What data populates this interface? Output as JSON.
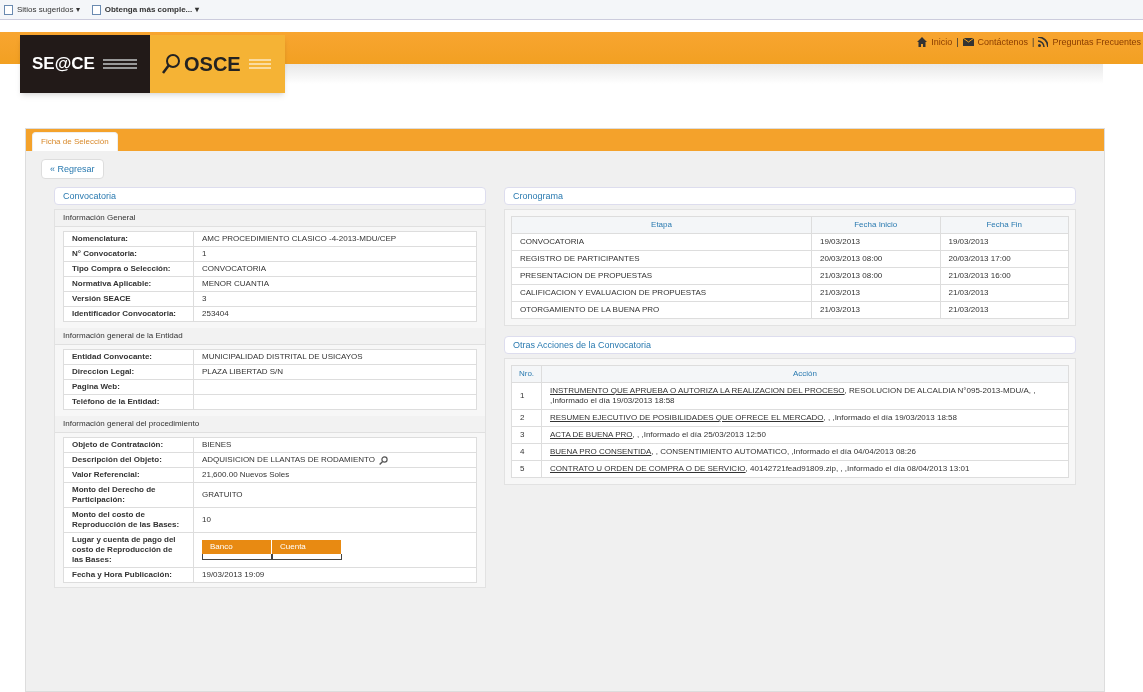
{
  "browser_bar": {
    "items": [
      "Sitios sugeridos ▾",
      "Obtenga más comple... ▾"
    ]
  },
  "header": {
    "logos": [
      "SE@CE",
      "OSCE"
    ],
    "separator": "|",
    "nav": [
      {
        "kind": "home",
        "label": "Inicio"
      },
      {
        "kind": "mail",
        "label": "Contáctenos"
      },
      {
        "kind": "rss",
        "label": "Preguntas Frecuentes"
      }
    ]
  },
  "tabs": [
    {
      "label": "Ficha de Selección",
      "selected": true
    }
  ],
  "back_button": "« Regresar",
  "convocatoria": {
    "legend": "Convocatoria",
    "sections": [
      {
        "title": "Información General",
        "rows": [
          {
            "kind": "text",
            "label": "Nomenclatura:",
            "value": "AMC PROCEDIMIENTO CLASICO -4-2013-MDU/CEP"
          },
          {
            "kind": "text",
            "label": "N° Convocatoria:",
            "value": "1"
          },
          {
            "kind": "text",
            "label": "Tipo Compra o Selección:",
            "value": "CONVOCATORIA"
          },
          {
            "kind": "text",
            "label": "Normativa Aplicable:",
            "value": "MENOR CUANTIA"
          },
          {
            "kind": "text",
            "label": "Versión SEACE",
            "value": "3"
          },
          {
            "kind": "text",
            "label": "Identificador Convocatoria:",
            "value": "253404"
          }
        ]
      },
      {
        "title": "Información general de la Entidad",
        "rows": [
          {
            "kind": "text",
            "label": "Entidad Convocante:",
            "value": "MUNICIPALIDAD DISTRITAL DE USICAYOS"
          },
          {
            "kind": "text",
            "label": "Direccion Legal:",
            "value": "PLAZA LIBERTAD S/N"
          },
          {
            "kind": "text",
            "label": "Pagina Web:"
          },
          {
            "kind": "text",
            "label": "Teléfono de la Entidad:"
          }
        ]
      },
      {
        "title": "Información general del procedimiento",
        "rows": [
          {
            "kind": "text",
            "label": "Objeto de Contratación:",
            "value": "BIENES"
          },
          {
            "kind": "search",
            "label": "Descripción del Objeto:",
            "value": "ADQUISICION DE LLANTAS DE RODAMIENTO"
          },
          {
            "kind": "text",
            "label": "Valor Referencial:",
            "value": "21,600.00 Nuevos Soles"
          },
          {
            "kind": "text",
            "label": "Monto del Derecho de Participación:",
            "value": "GRATUITO"
          },
          {
            "kind": "text",
            "label": "Monto del costo de Reproducción de las Bases:",
            "value": "10"
          },
          {
            "kind": "table",
            "label": "Lugar y cuenta de pago del costo de Reproducción de las Bases:",
            "columns": [
              "Banco",
              "Cuenta"
            ]
          },
          {
            "kind": "text",
            "label": "Fecha y Hora Publicación:",
            "value": "19/03/2013 19:09"
          }
        ]
      }
    ]
  },
  "cronograma": {
    "legend": "Cronograma",
    "columns": [
      "Etapa",
      "Fecha Inicio",
      "Fecha Fin"
    ],
    "rows": [
      [
        "CONVOCATORIA",
        "19/03/2013",
        "19/03/2013"
      ],
      [
        "REGISTRO DE PARTICIPANTES",
        "20/03/2013 08:00",
        "20/03/2013 17:00"
      ],
      [
        "PRESENTACION DE PROPUESTAS",
        "21/03/2013 08:00",
        "21/03/2013 16:00"
      ],
      [
        "CALIFICACION Y EVALUACION DE PROPUESTAS",
        "21/03/2013",
        "21/03/2013"
      ],
      [
        "OTORGAMIENTO DE LA BUENA PRO",
        "21/03/2013",
        "21/03/2013"
      ]
    ]
  },
  "acciones": {
    "legend": "Otras Acciones de la Convocatoria",
    "columns": [
      "Nro.",
      "Acción"
    ],
    "rows": [
      {
        "no": "1",
        "link": "INSTRUMENTO QUE APRUEBA O AUTORIZA LA REALIZACION DEL PROCESO",
        "text": ", RESOLUCION DE ALCALDIA N°095-2013-MDU/A, , ,Informado el día 19/03/2013 18:58"
      },
      {
        "no": "2",
        "link": "RESUMEN EJECUTIVO DE POSIBILIDADES QUE OFRECE EL MERCADO",
        "text": ", , ,Informado el día 19/03/2013 18:58"
      },
      {
        "no": "3",
        "link": "ACTA DE BUENA PRO",
        "text": ", , ,Informado el día 25/03/2013 12:50"
      },
      {
        "no": "4",
        "link": "BUENA PRO CONSENTIDA",
        "text": ", , CONSENTIMIENTO AUTOMATICO, ,Informado el día 04/04/2013 08:26"
      },
      {
        "no": "5",
        "link": "CONTRATO U ORDEN DE COMPRA O DE SERVICIO",
        "text": ", 40142721fead91809.zip, , ,Informado el día 08/04/2013 13:01"
      }
    ]
  }
}
